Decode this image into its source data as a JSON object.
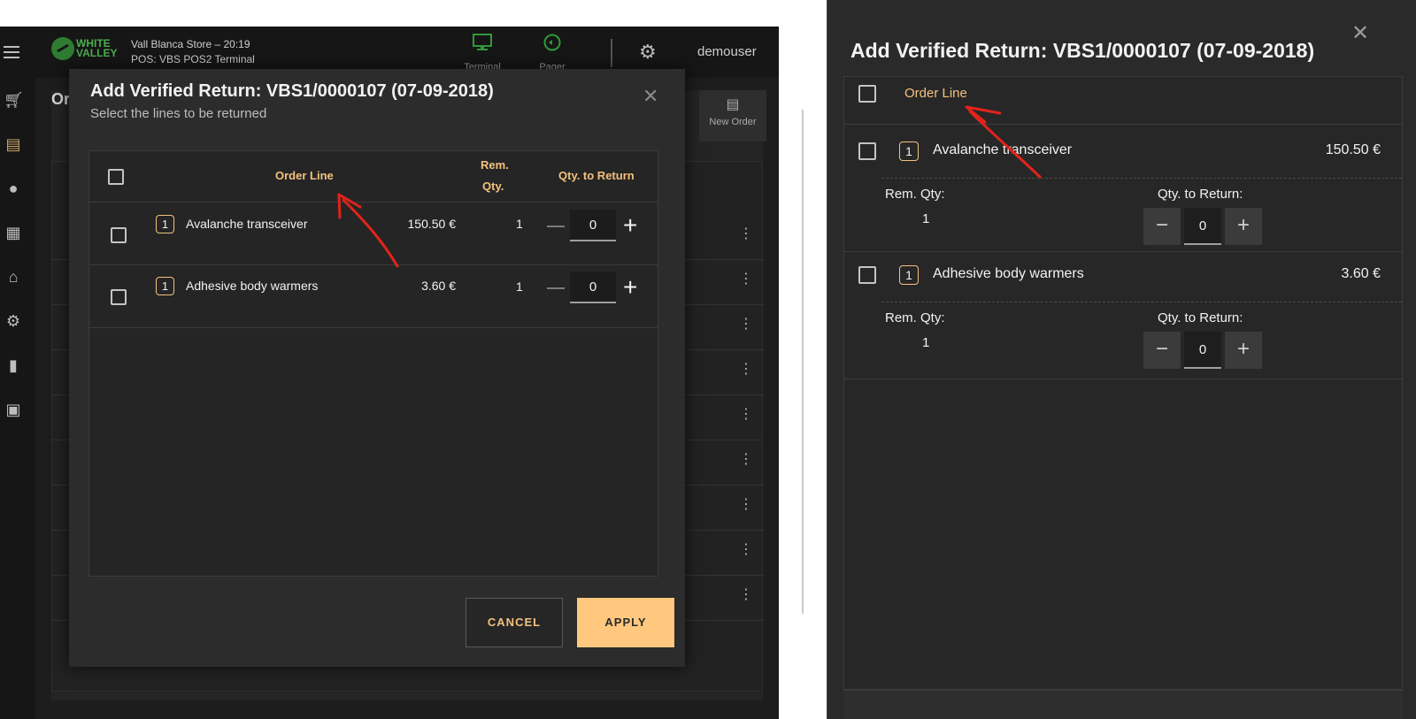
{
  "pos": {
    "logo_line1": "WHITE",
    "logo_line2": "VALLEY",
    "store_line": "Vall Blanca Store – 20:19",
    "terminal_line": "POS: VBS POS2 Terminal",
    "terminal_btn": "Terminal",
    "pager_btn": "Pager",
    "username": "demouser",
    "main_title": "Or",
    "new_order": "New Order",
    "accent_color": "#c8a565"
  },
  "modal": {
    "title": "Add Verified Return: VBS1/0000107 (07-09-2018)",
    "subtitle": "Select the lines to be returned",
    "headers": {
      "order_line": "Order Line",
      "rem_qty_1": "Rem.",
      "rem_qty_2": "Qty.",
      "qty_to_return": "Qty. to Return"
    },
    "rows": [
      {
        "qty_badge": "1",
        "name": "Avalanche transceiver",
        "price": "150.50 €",
        "rem_qty": "1",
        "return_qty": "0"
      },
      {
        "qty_badge": "1",
        "name": "Adhesive body warmers",
        "price": "3.60 €",
        "rem_qty": "1",
        "return_qty": "0"
      }
    ],
    "cancel_label": "CANCEL",
    "apply_label": "APPLY",
    "header_color": "#f3c27d",
    "apply_color": "#ffc87e"
  },
  "mobile": {
    "title": "Add Verified Return: VBS1/0000107 (07-09-2018)",
    "order_line": "Order Line",
    "rem_qty_label": "Rem. Qty:",
    "qty_to_return_label": "Qty. to Return:",
    "rows": [
      {
        "qty_badge": "1",
        "name": "Avalanche transceiver",
        "price": "150.50 €",
        "rem_qty": "1",
        "return_qty": "0"
      },
      {
        "qty_badge": "1",
        "name": "Adhesive body warmers",
        "price": "3.60 €",
        "rem_qty": "1",
        "return_qty": "0"
      }
    ]
  },
  "icons": {
    "menu": "hamburger-icon",
    "cart": "cart-icon",
    "orders": "receipt-icon",
    "customer": "person-icon",
    "cash": "cash-register-icon",
    "store": "store-icon",
    "settings": "gear-icon",
    "document": "document-icon",
    "printer": "printer-icon",
    "close": "close-icon",
    "annotation": "red-arrow-annotation"
  }
}
